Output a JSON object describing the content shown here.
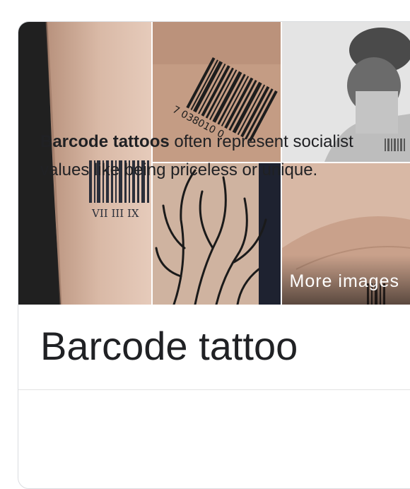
{
  "knowledge_panel": {
    "images": [
      {
        "name": "wrist-barcode-roman-numerals",
        "caption_text": "VII III IX"
      },
      {
        "name": "forearm-barcode-numbers",
        "caption_text": "7 038010 0"
      },
      {
        "name": "nape-barcode-tattoo"
      },
      {
        "name": "tree-branches-tattoo"
      },
      {
        "name": "inner-wrist-barcode-tattoo"
      }
    ],
    "more_images_label": "More images",
    "title": "Barcode tattoo",
    "description_bold": "Barcode tattoos",
    "description_rest": " often represent socialist values like being priceless or unique."
  },
  "colors": {
    "title_text": "#202124",
    "border": "#dadce0",
    "skin": "#c9a58f"
  }
}
